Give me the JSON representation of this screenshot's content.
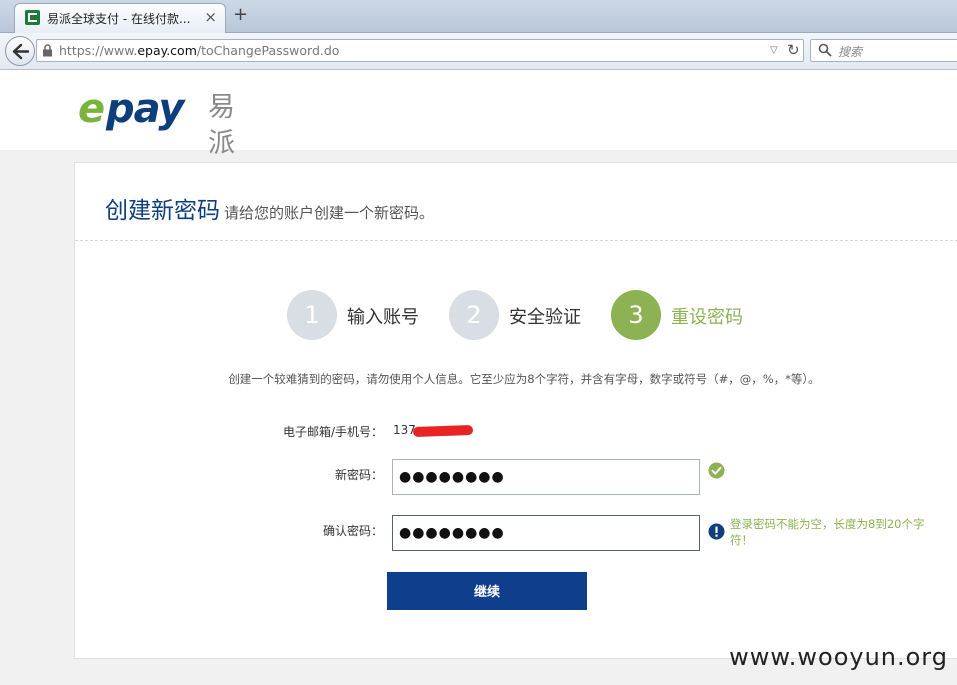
{
  "browser": {
    "tab_title": "易派全球支付 - 在线付款...",
    "url_prefix": "https://www.",
    "url_domain": "epay.com",
    "url_path": "/toChangePassword.do",
    "search_placeholder": "搜索"
  },
  "header": {
    "logo_e": "e",
    "logo_pay": "pay",
    "logo_cn": "易派"
  },
  "card": {
    "title": "创建新密码",
    "subtitle": "请给您的账户创建一个新密码。"
  },
  "steps": [
    {
      "number": "1",
      "label": "输入账号",
      "state": "done"
    },
    {
      "number": "2",
      "label": "安全验证",
      "state": "done"
    },
    {
      "number": "3",
      "label": "重设密码",
      "state": "active"
    }
  ],
  "hint": "创建一个较难猜到的密码，请勿使用个人信息。它至少应为8个字符，并含有字母，数字或符号（#，@，%，*等）。",
  "form": {
    "email_label": "电子邮箱/手机号：",
    "email_value": "137",
    "new_password_label": "新密码：",
    "new_password_value": "●●●●●●●●",
    "confirm_password_label": "确认密码：",
    "confirm_password_value": "●●●●●●●●",
    "error_message": "登录密码不能为空，长度为8到20个字符！",
    "submit_label": "继续"
  },
  "watermark": "www.wooyun.org",
  "colors": {
    "brand_blue": "#0e3e7c",
    "brand_green": "#8cb253",
    "button_blue": "#0e3e8c"
  }
}
